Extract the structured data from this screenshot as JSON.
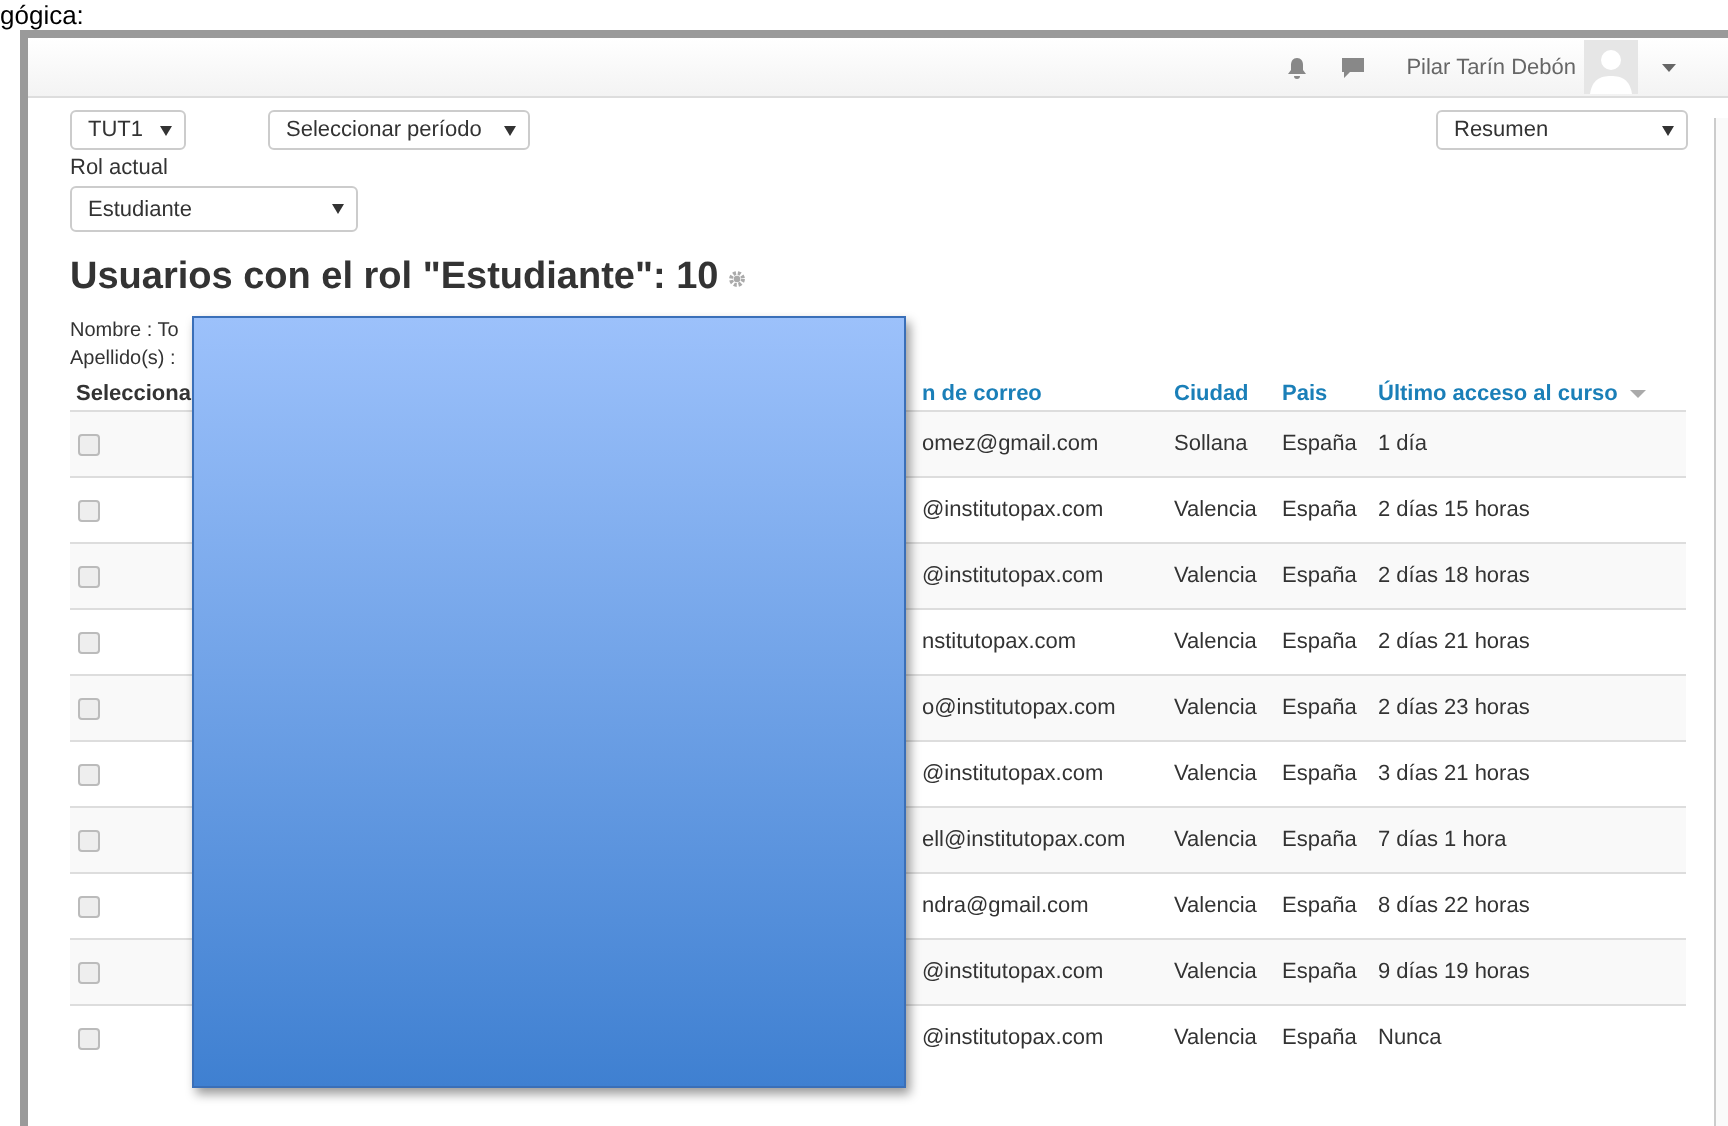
{
  "caption_fragment": "gógica:",
  "navbar": {
    "user_name": "Pilar Tarín Debón"
  },
  "filters": {
    "group": "TUT1",
    "period": "Seleccionar período",
    "view": "Resumen",
    "role_label": "Rol actual",
    "role": "Estudiante"
  },
  "heading": "Usuarios con el rol \"Estudiante\": 10",
  "initials": [
    {
      "label": "Nombre : To"
    },
    {
      "label": "Apellido(s) :"
    }
  ],
  "table": {
    "columns": [
      "Selecciona",
      "n de correo",
      "Ciudad",
      "Pais",
      "Último acceso al curso"
    ],
    "rows": [
      {
        "checked": false,
        "email": "omez@gmail.com",
        "city": "Sollana",
        "country": "España",
        "last_access": "1 día"
      },
      {
        "checked": false,
        "email": "@institutopax.com",
        "city": "Valencia",
        "country": "España",
        "last_access": "2 días 15 horas"
      },
      {
        "checked": false,
        "email": "@institutopax.com",
        "city": "Valencia",
        "country": "España",
        "last_access": "2 días 18 horas"
      },
      {
        "checked": false,
        "email": "nstitutopax.com",
        "city": "Valencia",
        "country": "España",
        "last_access": "2 días 21 horas"
      },
      {
        "checked": false,
        "email": "o@institutopax.com",
        "city": "Valencia",
        "country": "España",
        "last_access": "2 días 23 horas"
      },
      {
        "checked": false,
        "email": "@institutopax.com",
        "city": "Valencia",
        "country": "España",
        "last_access": "3 días 21 horas"
      },
      {
        "checked": false,
        "email": "ell@institutopax.com",
        "city": "Valencia",
        "country": "España",
        "last_access": "7 días 1 hora"
      },
      {
        "checked": false,
        "email": "ndra@gmail.com",
        "city": "Valencia",
        "country": "España",
        "last_access": "8 días 22 horas"
      },
      {
        "checked": false,
        "email": "@institutopax.com",
        "city": "Valencia",
        "country": "España",
        "last_access": "9 días 19 horas"
      },
      {
        "checked": false,
        "email": "@institutopax.com",
        "city": "Valencia",
        "country": "España",
        "last_access": "Nunca"
      }
    ]
  }
}
